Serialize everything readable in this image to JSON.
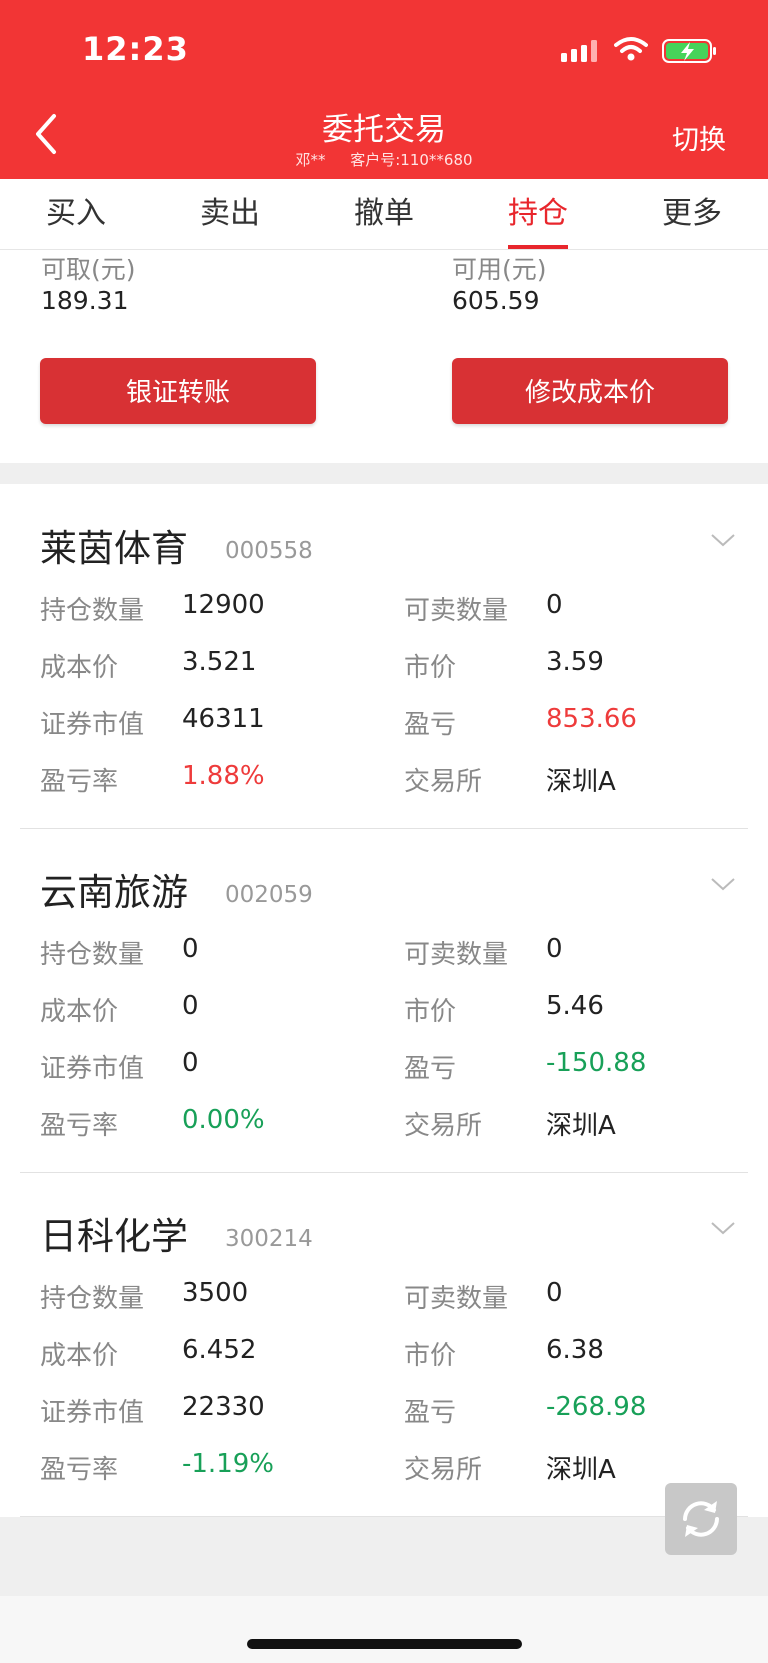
{
  "status_bar": {
    "time": "12:23"
  },
  "header": {
    "title": "委托交易",
    "user": "邓**",
    "account": "客户号:110**680",
    "switch_label": "切换",
    "accent": "#f23535"
  },
  "tabs": [
    "买入",
    "卖出",
    "撤单",
    "持仓",
    "更多"
  ],
  "active_tab": "持仓",
  "funds": {
    "withdrawable_label": "可取(元)",
    "withdrawable_value": "189.31",
    "available_label": "可用(元)",
    "available_value": "605.59",
    "transfer_button": "银证转账",
    "modify_cost_button": "修改成本价"
  },
  "labels": {
    "hold_qty": "持仓数量",
    "sellable_qty": "可卖数量",
    "cost_price": "成本价",
    "market_price": "市价",
    "market_value": "证券市值",
    "pnl": "盈亏",
    "pnl_rate": "盈亏率",
    "exchange": "交易所"
  },
  "positions": [
    {
      "name": "莱茵体育",
      "code": "000558",
      "hold_qty": "12900",
      "sellable_qty": "0",
      "cost_price": "3.521",
      "market_price": "3.59",
      "market_value": "46311",
      "pnl": "853.66",
      "pnl_rate": "1.88%",
      "exchange": "深圳A"
    },
    {
      "name": "云南旅游",
      "code": "002059",
      "hold_qty": "0",
      "sellable_qty": "0",
      "cost_price": "0",
      "market_price": "5.46",
      "market_value": "0",
      "pnl": "-150.88",
      "pnl_rate": "0.00%",
      "exchange": "深圳A"
    },
    {
      "name": "日科化学",
      "code": "300214",
      "hold_qty": "3500",
      "sellable_qty": "0",
      "cost_price": "6.452",
      "market_price": "6.38",
      "market_value": "22330",
      "pnl": "-268.98",
      "pnl_rate": "-1.19%",
      "exchange": "深圳A"
    }
  ],
  "colors": {
    "gain": "#ee3b3b",
    "loss": "#18a058"
  },
  "icons": [
    "signal-icon",
    "wifi-icon",
    "battery-charging-icon",
    "back-icon",
    "chevron-down-icon",
    "refresh-icon"
  ]
}
